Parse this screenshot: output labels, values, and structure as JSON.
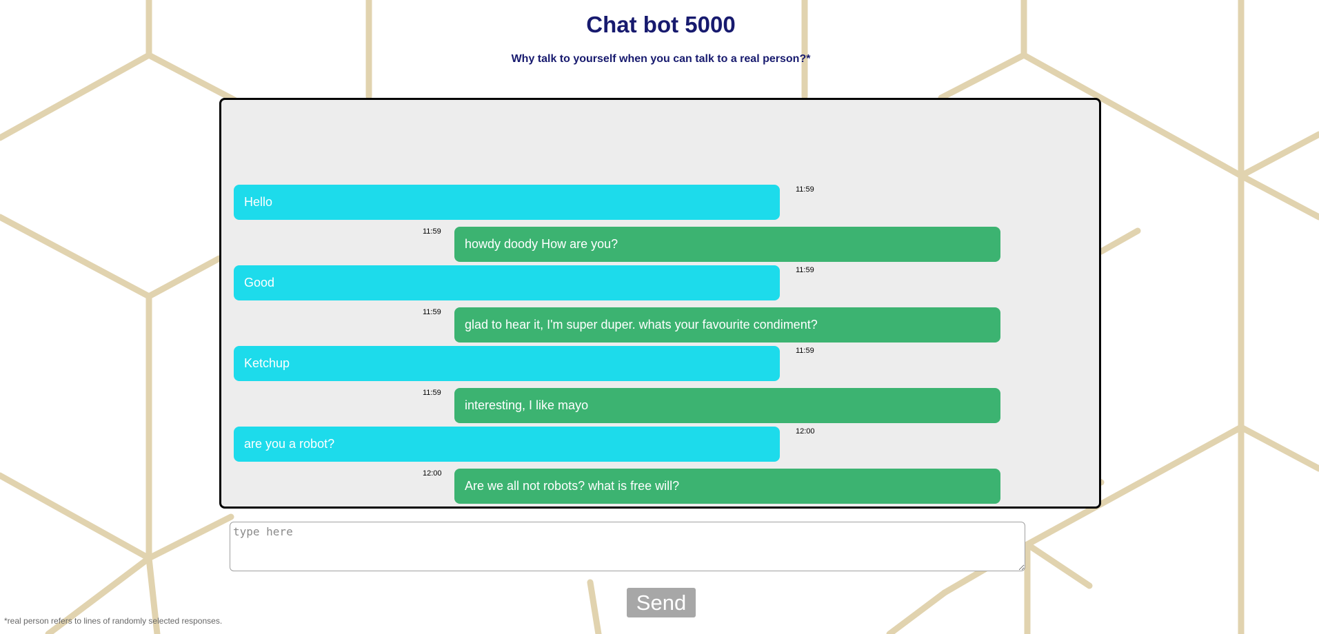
{
  "page": {
    "title": "Chat bot 5000",
    "subtitle": "Why talk to yourself when you can talk to a real person?*",
    "footnote": "*real person refers to lines of randomly selected responses."
  },
  "chat": {
    "messages": [
      {
        "sender": "user",
        "text": "Hello",
        "time": "11:59"
      },
      {
        "sender": "bot",
        "text": "howdy doody How are you?",
        "time": "11:59"
      },
      {
        "sender": "user",
        "text": "Good",
        "time": "11:59"
      },
      {
        "sender": "bot",
        "text": "glad to hear it, I'm super duper. whats your favourite condiment?",
        "time": "11:59"
      },
      {
        "sender": "user",
        "text": "Ketchup",
        "time": "11:59"
      },
      {
        "sender": "bot",
        "text": "interesting, I like mayo",
        "time": "11:59"
      },
      {
        "sender": "user",
        "text": "are you a robot?",
        "time": "12:00"
      },
      {
        "sender": "bot",
        "text": "Are we all not robots? what is free will?",
        "time": "12:00"
      }
    ]
  },
  "input": {
    "placeholder": "type here",
    "value": ""
  },
  "send": {
    "label": "Send"
  },
  "colors": {
    "heading": "#171a6e",
    "user_bubble": "#1ddbeb",
    "bot_bubble": "#3cb371",
    "chat_background": "#ededed",
    "pattern_lines": "#e1d3af",
    "send_button": "#a7a7a7"
  }
}
